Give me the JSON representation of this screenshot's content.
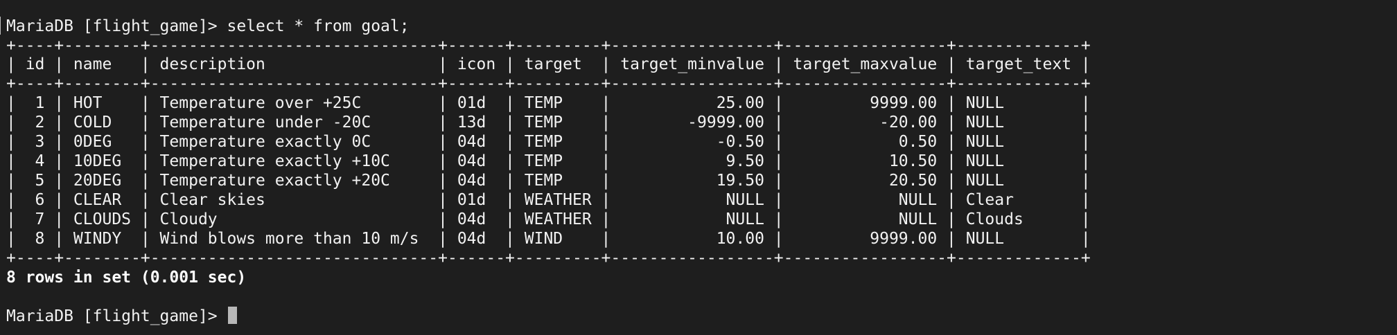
{
  "terminal": {
    "prompt": "MariaDB [flight_game]> ",
    "command": "select * from goal;",
    "table_border": "+----+--------+------------------------------+------+---------+-----------------+-----------------+-------------+",
    "table_header": "| id | name   | description                  | icon | target  | target_minvalue | target_maxvalue | target_text |",
    "columns": [
      "id",
      "name",
      "description",
      "icon",
      "target",
      "target_minvalue",
      "target_maxvalue",
      "target_text"
    ],
    "rows": [
      "|  1 | HOT    | Temperature over +25C        | 01d  | TEMP    |           25.00 |         9999.00 | NULL        |",
      "|  2 | COLD   | Temperature under -20C       | 13d  | TEMP    |        -9999.00 |          -20.00 | NULL        |",
      "|  3 | 0DEG   | Temperature exactly 0C       | 04d  | TEMP    |           -0.50 |            0.50 | NULL        |",
      "|  4 | 10DEG  | Temperature exactly +10C     | 04d  | TEMP    |            9.50 |           10.50 | NULL        |",
      "|  5 | 20DEG  | Temperature exactly +20C     | 04d  | TEMP    |           19.50 |           20.50 | NULL        |",
      "|  6 | CLEAR  | Clear skies                  | 01d  | WEATHER |            NULL |            NULL | Clear       |",
      "|  7 | CLOUDS | Cloudy                       | 04d  | WEATHER |            NULL |            NULL | Clouds      |",
      "|  8 | WINDY  | Wind blows more than 10 m/s  | 04d  | WIND    |           10.00 |         9999.00 | NULL        |"
    ],
    "result_summary": "8 rows in set (0.001 sec)",
    "final_prompt": "MariaDB [flight_game]> "
  },
  "colors": {
    "background": "#1e1e1e",
    "text": "#f2f2f2",
    "cursor": "#b8b8b8"
  }
}
